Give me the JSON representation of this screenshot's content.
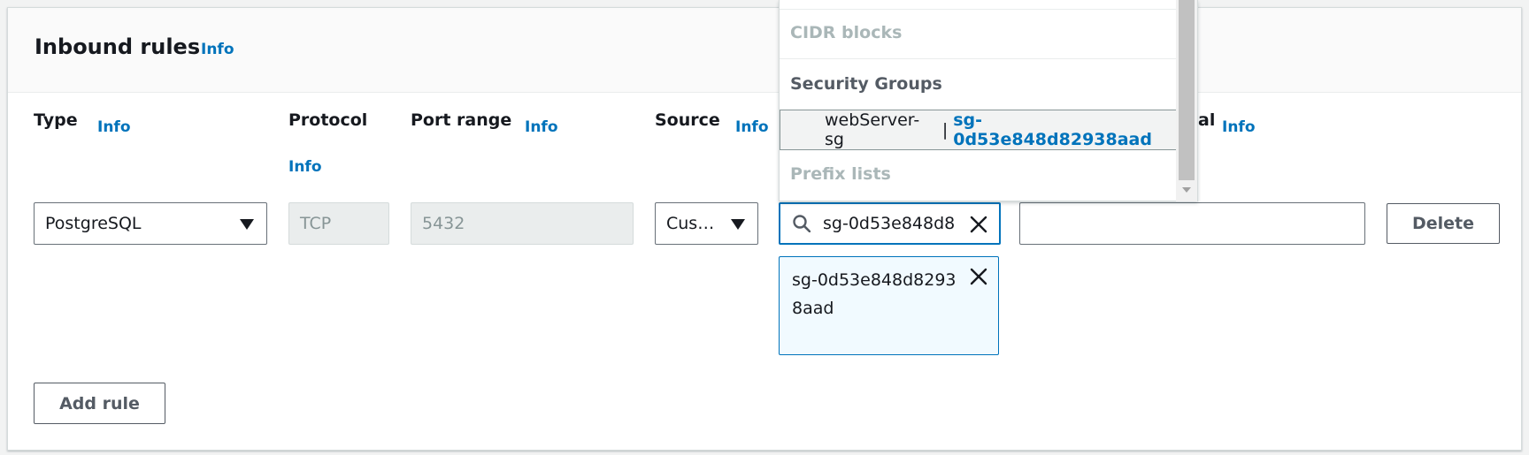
{
  "header": {
    "title": "Inbound rules",
    "info": "Info"
  },
  "columns": {
    "type": {
      "label": "Type",
      "info": "Info"
    },
    "protocol": {
      "label": "Protocol",
      "info": "Info"
    },
    "port_range": {
      "label": "Port range",
      "info": "Info"
    },
    "source": {
      "label": "Source",
      "info": "Info"
    },
    "description": {
      "label_visible_fragment": "al",
      "info": "Info"
    }
  },
  "rule": {
    "type_value": "PostgreSQL",
    "protocol_value": "TCP",
    "port_value": "5432",
    "source_type_value": "Cus…",
    "source_search_value": "sg-0d53e848d8",
    "token_value": "sg-0d53e848d82938aad",
    "delete_label": "Delete"
  },
  "dropdown": {
    "groups": [
      "CIDR blocks",
      "Security Groups",
      "Prefix lists"
    ],
    "option": {
      "name": "webServer-sg",
      "separator": "|",
      "id": "sg-0d53e848d82938aad"
    }
  },
  "actions": {
    "add_rule_label": "Add rule"
  },
  "colors": {
    "accent": "#0073bb",
    "text": "#16191f",
    "muted": "#879596",
    "token_bg": "#f1faff"
  },
  "icons": {
    "search": "search-icon",
    "clear": "close-icon",
    "remove_token": "close-icon",
    "caret": "caret-down-icon"
  }
}
